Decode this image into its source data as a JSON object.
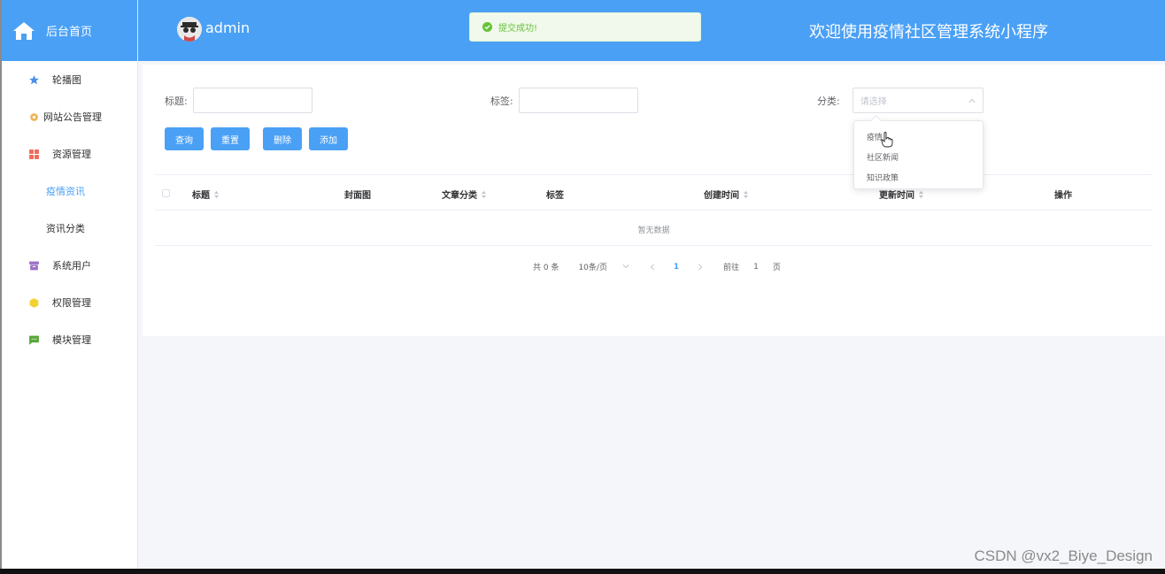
{
  "brand": {
    "title": "后台首页"
  },
  "header": {
    "username": "admin",
    "welcome": "欢迎使用疫情社区管理系统小程序"
  },
  "toast": {
    "message": "提交成功!"
  },
  "sidebar": {
    "items": [
      {
        "label": "轮播图"
      },
      {
        "label": "网站公告管理"
      },
      {
        "label": "资源管理"
      },
      {
        "label": "疫情资讯"
      },
      {
        "label": "资讯分类"
      },
      {
        "label": "系统用户"
      },
      {
        "label": "权限管理"
      },
      {
        "label": "模块管理"
      }
    ]
  },
  "filters": {
    "title_label": "标题:",
    "tag_label": "标签:",
    "category_label": "分类:",
    "category_placeholder": "请选择"
  },
  "buttons": {
    "query": "查询",
    "reset": "重置",
    "delete": "删除",
    "add": "添加"
  },
  "table": {
    "columns": [
      "标题",
      "封面图",
      "文章分类",
      "标签",
      "创建时间",
      "更新时间",
      "操作"
    ],
    "empty_text": "暂无数据"
  },
  "pagination": {
    "total": "共 0 条",
    "page_size": "10条/页",
    "current": "1",
    "goto_prefix": "前往",
    "goto_value": "1",
    "goto_suffix": "页"
  },
  "dropdown": {
    "options": [
      "疫情",
      "社区新闻",
      "知识政策"
    ]
  },
  "watermark": "CSDN @vx2_Biye_Design",
  "colors": {
    "primary": "#4aa0f5",
    "success": "#67c23a",
    "toast_bg": "#f0f9eb"
  }
}
